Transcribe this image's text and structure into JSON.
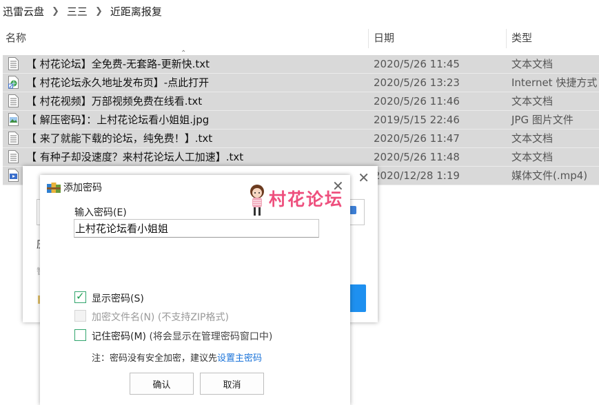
{
  "breadcrumb": [
    "迅雷云盘",
    "三三",
    "近距离报复"
  ],
  "columns": {
    "name": "名称",
    "date": "日期",
    "type": "类型"
  },
  "files": [
    {
      "icon": "text-file-icon",
      "name": "【 村花论坛】全免费-无套路-更新快.txt",
      "date": "2020/5/26 11:45",
      "type": "文本文档"
    },
    {
      "icon": "internet-shortcut-icon",
      "name": "【 村花论坛永久地址发布页】-点此打开",
      "date": "2020/5/26 13:23",
      "type": "Internet 快捷方式"
    },
    {
      "icon": "text-file-icon",
      "name": "【 村花视频】万部视频免费在线看.txt",
      "date": "2020/5/26 11:46",
      "type": "文本文档"
    },
    {
      "icon": "image-file-icon",
      "name": "【 解压密码】：上村花论坛看小姐姐.jpg",
      "date": "2019/5/15 22:46",
      "type": "JPG 图片文件"
    },
    {
      "icon": "text-file-icon",
      "name": "【 来了就能下载的论坛，纯免费！】.txt",
      "date": "2020/5/26 11:47",
      "type": "文本文档"
    },
    {
      "icon": "text-file-icon",
      "name": "【 有种子却没速度？来村花论坛人工加速】.txt",
      "date": "2020/5/26 11:48",
      "type": "文本文档"
    },
    {
      "icon": "video-file-icon",
      "name": "",
      "date": "2020/12/28 1:19",
      "type": "媒体文件(.mp4)"
    }
  ],
  "bg_dialog": {
    "label_fragment": "压",
    "faded_fragment": "智"
  },
  "dialog": {
    "title": "添加密码",
    "logo_text": "村花论坛",
    "password_label": "输入密码(E)",
    "password_value": "上村花论坛看小姐姐",
    "show_password": {
      "label": "显示密码(S)",
      "checked": true
    },
    "encrypt_names": {
      "label": "加密文件名(N)",
      "note": "(不支持ZIP格式)",
      "disabled": true
    },
    "remember_password": {
      "label": "记住密码(M)",
      "note": "(将会显示在管理密码窗口中)",
      "checked": false
    },
    "note_text": "注：密码没有安全加密，建议先",
    "note_link": "设置主密码",
    "ok_label": "确认",
    "cancel_label": "取消"
  },
  "colors": {
    "selection": "#d9d9d9",
    "accent_blue": "#1e90f0",
    "check_green": "#1a9d4f",
    "logo_pink": "#ee4f7d"
  }
}
